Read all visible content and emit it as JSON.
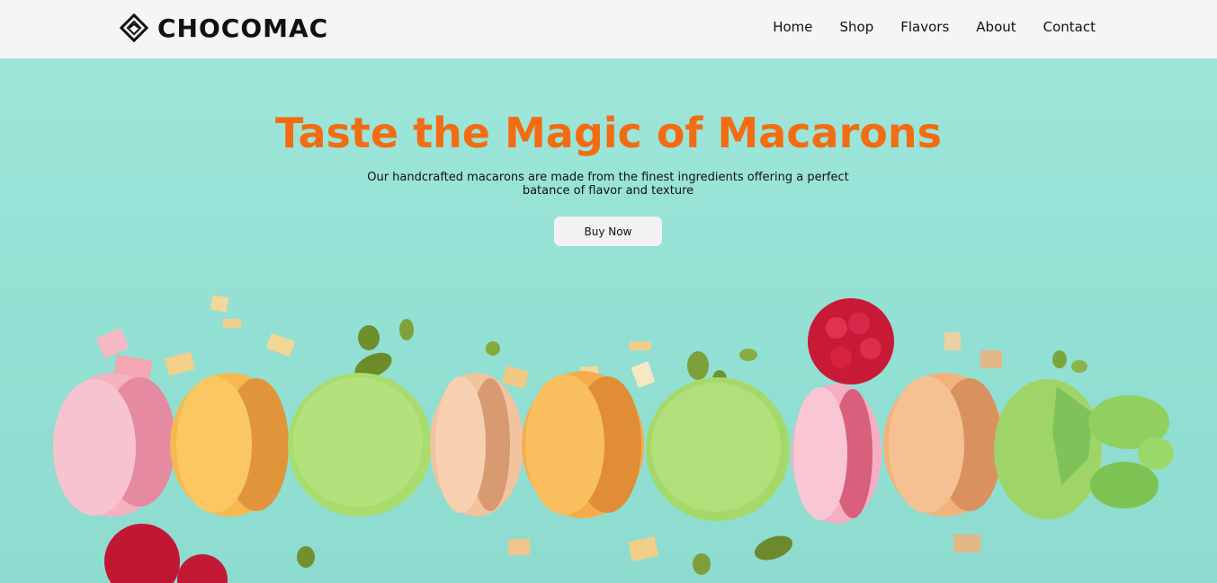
{
  "header": {
    "brand_name": "CHOCOMAC",
    "logo_icon": "diamond-logo-icon",
    "nav": [
      {
        "label": "Home"
      },
      {
        "label": "Shop"
      },
      {
        "label": "Flavors"
      },
      {
        "label": "About"
      },
      {
        "label": "Contact"
      }
    ]
  },
  "hero": {
    "title": "Taste the Magic of Macarons",
    "subtitle_line1": "Our handcrafted macarons are made from the finest ingredients offering a perfect",
    "subtitle_line2": "batance of flavor and texture",
    "button_label": "Buy Now",
    "image": "macarons-row-photo"
  },
  "colors": {
    "accent": "#f36c12",
    "hero_background": "#94e2d6",
    "header_background": "#f5f5f5"
  }
}
